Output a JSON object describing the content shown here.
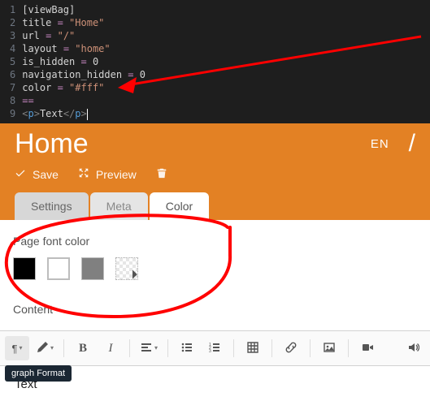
{
  "code": {
    "lines": [
      {
        "n": "1",
        "raw": "[viewBag]"
      },
      {
        "n": "2",
        "raw": "title = \"Home\""
      },
      {
        "n": "3",
        "raw": "url = \"/\""
      },
      {
        "n": "4",
        "raw": "layout = \"home\""
      },
      {
        "n": "5",
        "raw": "is_hidden = 0"
      },
      {
        "n": "6",
        "raw": "navigation_hidden = 0"
      },
      {
        "n": "7",
        "raw": "color = \"#fff\""
      },
      {
        "n": "8",
        "raw": "=="
      },
      {
        "n": "9",
        "raw": "<p>Text</p>"
      }
    ]
  },
  "header": {
    "title": "Home",
    "lang": "EN",
    "slash": "/",
    "actions": {
      "save": "Save",
      "preview": "Preview"
    }
  },
  "tabs": {
    "settings": "Settings",
    "meta": "Meta",
    "color": "Color"
  },
  "color_field": {
    "label": "Page font color",
    "swatches": [
      "#000000",
      "#ffffff",
      "#808080",
      "transparent"
    ]
  },
  "content": {
    "label": "Content",
    "body": "Text"
  },
  "toolbar": {
    "tooltip_paragraph": "graph Format"
  }
}
